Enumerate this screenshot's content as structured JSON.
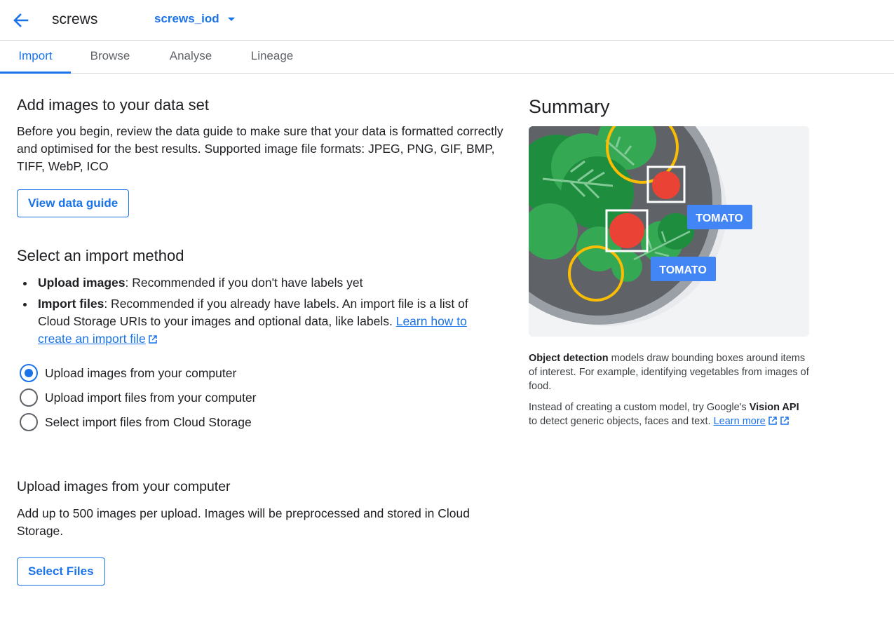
{
  "header": {
    "back_icon": "arrow-back-icon",
    "title": "screws",
    "dataset": "screws_iod"
  },
  "tabs": [
    {
      "label": "Import",
      "active": true
    },
    {
      "label": "Browse",
      "active": false
    },
    {
      "label": "Analyse",
      "active": false
    },
    {
      "label": "Lineage",
      "active": false
    }
  ],
  "add_images": {
    "heading": "Add images to your data set",
    "description": "Before you begin, review the data guide to make sure that your data is formatted correctly and optimised for the best results. Supported image file formats: JPEG, PNG, GIF, BMP, TIFF, WebP, ICO",
    "button": "View data guide"
  },
  "import_method": {
    "heading": "Select an import method",
    "bullet1_bold": "Upload images",
    "bullet1_text": ": Recommended if you don't have labels yet",
    "bullet2_bold": "Import files",
    "bullet2_text": ": Recommended if you already have labels. An import file is a list of Cloud Storage URIs to your images and optional data, like labels. ",
    "bullet2_link": "Learn how to create an import file",
    "options": [
      {
        "label": "Upload images from your computer",
        "checked": true
      },
      {
        "label": "Upload import files from your computer",
        "checked": false
      },
      {
        "label": "Select import files from Cloud Storage",
        "checked": false
      }
    ]
  },
  "upload": {
    "heading": "Upload images from your computer",
    "description": "Add up to 500 images per upload. Images will be preprocessed and stored in Cloud Storage.",
    "button": "Select Files"
  },
  "summary": {
    "title": "Summary",
    "label1": "TOMATO",
    "label2": "TOMATO",
    "p1_bold": "Object detection",
    "p1_text": " models draw bounding boxes around items of interest. For example, identifying vegetables from images of food.",
    "p2_text": "Instead of creating a custom model, try Google's ",
    "p2_bold": "Vision API",
    "p2_text2": " to detect generic objects, faces and text. ",
    "p2_link": "Learn more"
  },
  "colors": {
    "accent": "#1a73e8",
    "text": "#202124",
    "muted": "#5f6368",
    "divider": "#dadce0"
  }
}
